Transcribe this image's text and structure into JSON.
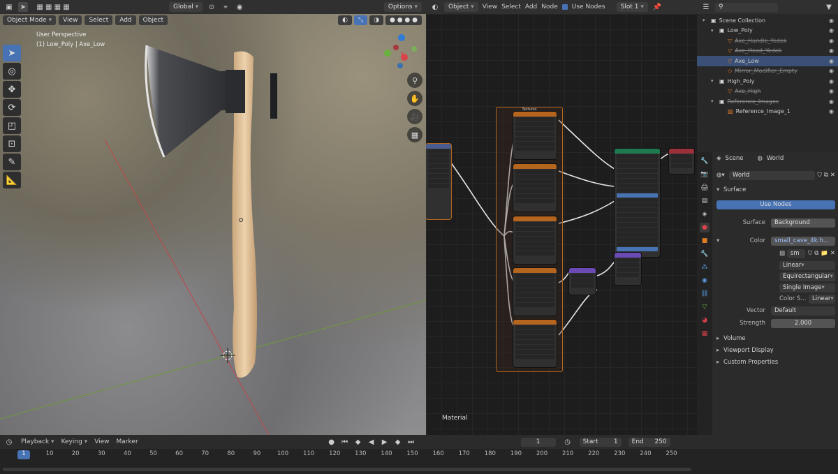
{
  "top_header": {
    "mode": "Object Mode",
    "view": "View",
    "select": "Select",
    "add": "Add",
    "object": "Object",
    "transform_orientation": "Global",
    "options": "Options"
  },
  "viewport": {
    "perspective": "User Perspective",
    "collection_info": "(1) Low_Poly | Axe_Low"
  },
  "node_editor": {
    "type": "Object",
    "view": "View",
    "select": "Select",
    "add": "Add",
    "node": "Node",
    "use_nodes": "Use Nodes",
    "slot": "Slot 1",
    "material_label": "Material",
    "frame_label": "Textures"
  },
  "outliner": {
    "items": [
      {
        "name": "Scene Collection",
        "indent": 0,
        "style": "normal"
      },
      {
        "name": "Low_Poly",
        "indent": 1,
        "style": "normal"
      },
      {
        "name": "Axe_Handle_Yedek",
        "indent": 2,
        "style": "dim"
      },
      {
        "name": "Axe_Head_Yedek",
        "indent": 2,
        "style": "dim"
      },
      {
        "name": "Axe_Low",
        "indent": 2,
        "style": "selected"
      },
      {
        "name": "Mirror_Modifier_Empty",
        "indent": 2,
        "style": "dim"
      },
      {
        "name": "High_Poly",
        "indent": 1,
        "style": "normal"
      },
      {
        "name": "Axe_High",
        "indent": 2,
        "style": "dim"
      },
      {
        "name": "Reference_Images",
        "indent": 1,
        "style": "dim"
      },
      {
        "name": "Reference_Image_1",
        "indent": 2,
        "style": "normal"
      }
    ]
  },
  "properties": {
    "breadcrumb_scene": "Scene",
    "breadcrumb_world": "World",
    "world_name": "World",
    "surface_panel": "Surface",
    "use_nodes": "Use Nodes",
    "surface_label": "Surface",
    "surface_value": "Background",
    "color_label": "Color",
    "color_value": "small_cave_4k.h...",
    "image_short": "sm",
    "interpolation": "Linear",
    "projection": "Equirectangular",
    "source": "Single Image",
    "color_space_label": "Color S...",
    "color_space_value": "Linear",
    "vector_label": "Vector",
    "vector_value": "Default",
    "strength_label": "Strength",
    "strength_value": "2.000",
    "volume": "Volume",
    "viewport_display": "Viewport Display",
    "custom_properties": "Custom Properties"
  },
  "timeline": {
    "playback": "Playback",
    "keying": "Keying",
    "view": "View",
    "marker": "Marker",
    "current_frame": "1",
    "start_label": "Start",
    "start_value": "1",
    "end_label": "End",
    "end_value": "250",
    "ticks": [
      "1",
      "10",
      "20",
      "30",
      "40",
      "50",
      "60",
      "70",
      "80",
      "90",
      "100",
      "110",
      "120",
      "130",
      "140",
      "150",
      "160",
      "170",
      "180",
      "190",
      "200",
      "210",
      "220",
      "230",
      "240",
      "250"
    ]
  },
  "colors": {
    "accent": "#4772b3",
    "header": "#303030",
    "texture_node": "#b5651d",
    "shader_node": "#1f7a4f",
    "vector_node": "#6b4ab5"
  }
}
